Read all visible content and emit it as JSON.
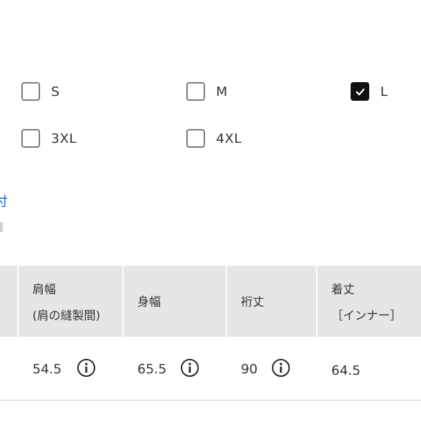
{
  "sizes": [
    {
      "label": "S",
      "checked": false
    },
    {
      "label": "M",
      "checked": false
    },
    {
      "label": "L",
      "checked": true
    },
    {
      "label": "3XL",
      "checked": false
    },
    {
      "label": "4XL",
      "checked": false
    }
  ],
  "edge_link": "付",
  "table": {
    "headers": {
      "shoulder_line1": "肩幅",
      "shoulder_line2": "(肩の縫製間)",
      "body_width": "身幅",
      "sleeve": "裄丈",
      "length_line1": "着丈",
      "length_line2": "［インナー］"
    },
    "row": {
      "shoulder": "54.5",
      "body_width": "65.5",
      "sleeve": "90",
      "length": "64.5"
    }
  },
  "colors": {
    "header_bg": "#e6e6e6",
    "checkbox_checked": "#111111",
    "link": "#1d5fbf"
  },
  "icons": [
    "check-icon",
    "info-icon"
  ]
}
